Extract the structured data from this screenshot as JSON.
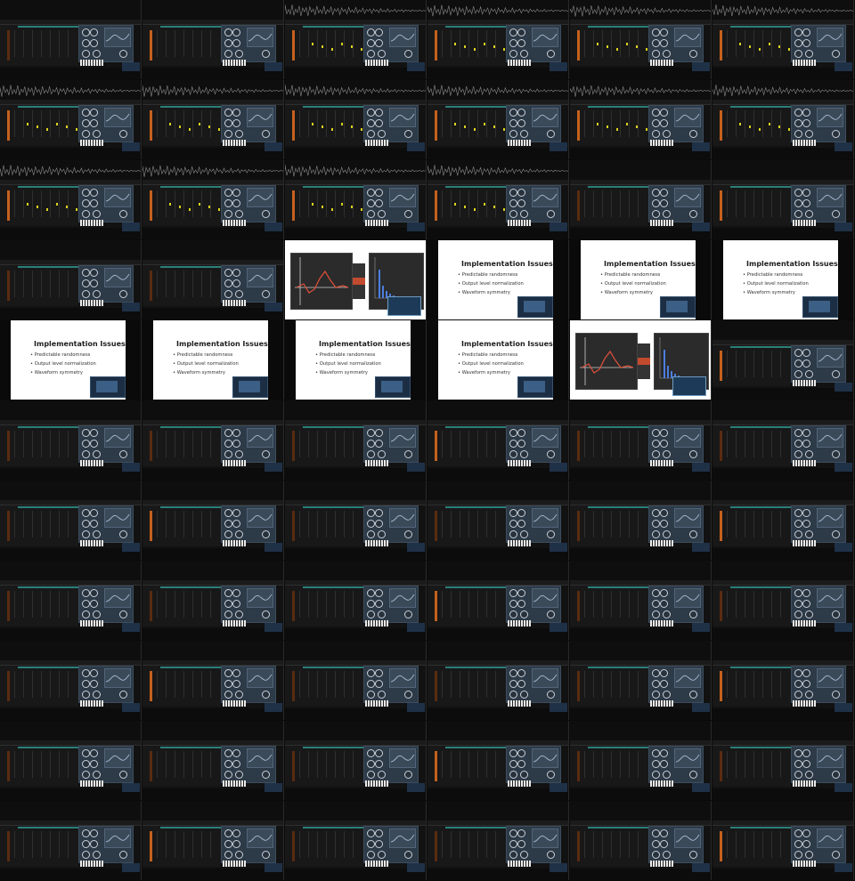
{
  "contact_sheet": {
    "columns": 6,
    "rows": 11,
    "slide_text": {
      "title": "Implementation Issues",
      "bullets": [
        "Predictable randomness",
        "Output level normalization",
        "Waveform symmetry"
      ]
    },
    "tiles": [
      "daw",
      "daw",
      "daw-wave",
      "daw-wave",
      "daw-wave",
      "daw-wave",
      "daw-wave",
      "daw-wave",
      "daw-wave",
      "daw-wave",
      "daw-wave",
      "daw-wave",
      "daw-wave",
      "daw-wave",
      "daw-wave",
      "daw-wave",
      "daw",
      "daw",
      "daw",
      "daw",
      "plot",
      "slide",
      "slide",
      "slide",
      "slide",
      "slide",
      "slide",
      "slide",
      "plot",
      "daw",
      "daw",
      "daw",
      "daw",
      "daw",
      "daw",
      "daw",
      "daw",
      "daw",
      "daw",
      "daw",
      "daw",
      "daw",
      "daw",
      "daw",
      "daw",
      "daw",
      "daw",
      "daw",
      "daw",
      "daw",
      "daw",
      "daw",
      "daw",
      "daw",
      "daw",
      "daw",
      "daw",
      "daw",
      "daw",
      "daw",
      "daw",
      "daw",
      "daw",
      "daw",
      "daw",
      "daw"
    ]
  },
  "colors": {
    "background": "#0b0b0b",
    "daw_panel": "#2d3a47",
    "meter_orange": "#c5611e",
    "track_teal": "#2b7f7a",
    "note_yellow": "#d9d51e",
    "plot_red": "#e0513b",
    "plot_blue": "#4c7de0"
  },
  "icons": [
    "knob-icon",
    "piano-keyboard-icon",
    "waveform-display-icon",
    "webcam-overlay-icon"
  ]
}
